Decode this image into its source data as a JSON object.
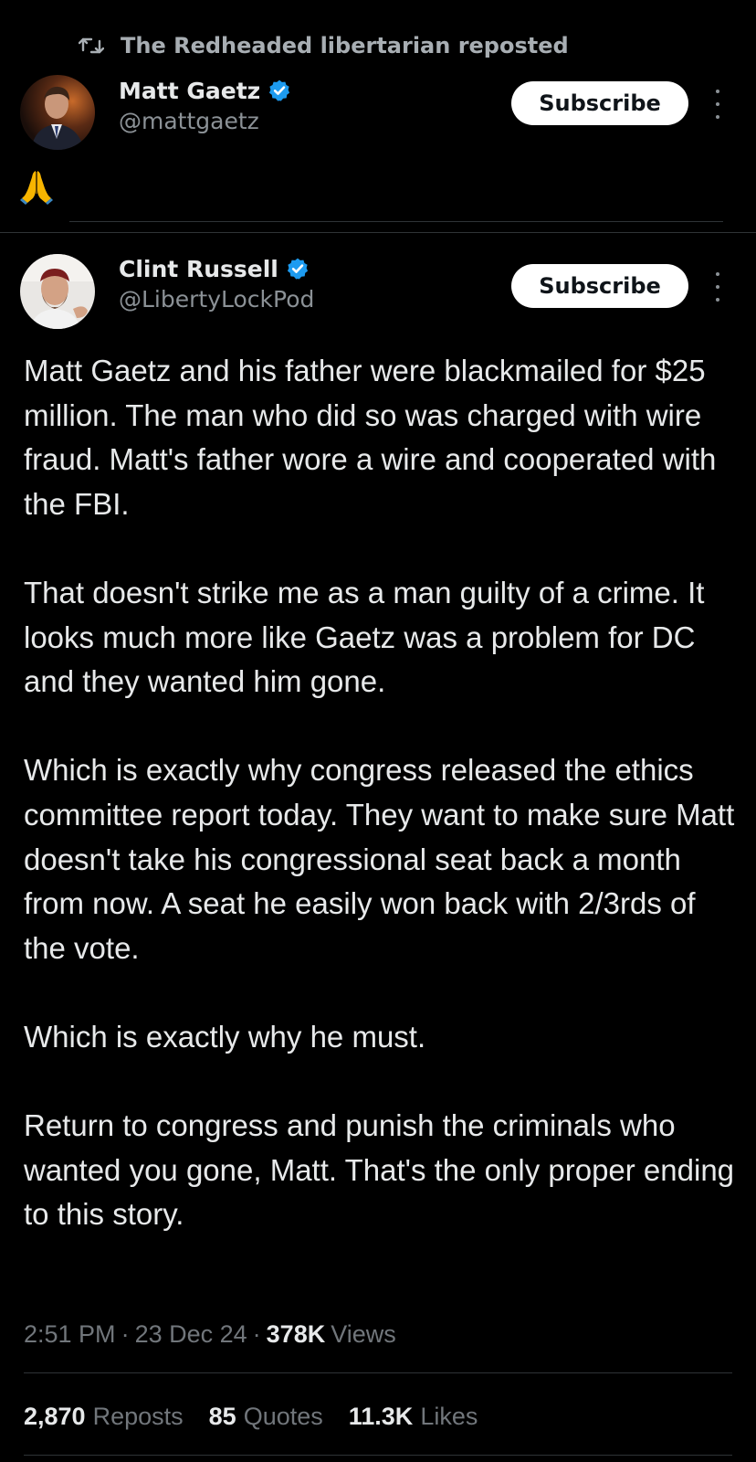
{
  "repost_banner": {
    "icon": "repost-icon",
    "text": "The Redheaded libertarian reposted"
  },
  "reposted_post": {
    "author_name": "Matt Gaetz",
    "verified_icon": "verified-badge-icon",
    "handle": "@mattgaetz",
    "subscribe_label": "Subscribe",
    "more_icon": "more-options-icon",
    "content_emoji": "🙏"
  },
  "quoted_post": {
    "author_name": "Clint Russell",
    "verified_icon": "verified-badge-icon",
    "handle": "@LibertyLockPod",
    "subscribe_label": "Subscribe",
    "more_icon": "more-options-icon",
    "paragraphs": [
      "Matt Gaetz and his father were blackmailed for $25 million. The man who did so was charged with wire fraud. Matt's father wore a wire and cooperated with the FBI.",
      "That doesn't strike me as a man guilty of a crime. It looks much more like Gaetz was a problem for DC and they wanted him gone.",
      "Which is exactly why congress released the ethics committee report today. They want to make sure Matt doesn't take his congressional seat back a month from now. A seat he easily won back with 2/3rds of the vote.",
      "Which is exactly why he must.",
      "Return to congress and punish the criminals who wanted you gone, Matt. That's the only proper ending to this story."
    ],
    "time": "2:51 PM",
    "separator": "·",
    "date": "23 Dec 24",
    "views_count": "378K",
    "views_label": "Views",
    "stats": {
      "reposts_count": "2,870",
      "reposts_label": "Reposts",
      "quotes_count": "85",
      "quotes_label": "Quotes",
      "likes_count": "11.3K",
      "likes_label": "Likes"
    }
  },
  "colors": {
    "background": "#000000",
    "primary_text": "#e7e9ea",
    "secondary_text": "#71767b",
    "verified_blue": "#1d9bf0",
    "divider": "#2f3336",
    "button_bg": "#ffffff"
  }
}
